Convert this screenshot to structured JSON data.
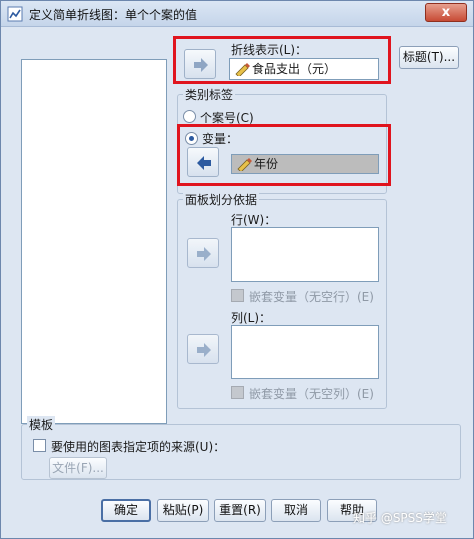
{
  "window": {
    "title": "定义简单折线图：单个个案的值",
    "close_label": "x"
  },
  "line_represents": {
    "label": "折线表示(L)：",
    "value": "食品支出（元）"
  },
  "titles_button": "标题(T)...",
  "category_labels": {
    "legend": "类别标签",
    "case_number_label": "个案号(C)",
    "variable_label": "变量：",
    "variable_value": "年份"
  },
  "panel_by": {
    "legend": "面板划分依据",
    "rows_label": "行(W)：",
    "rows_nest_label": "嵌套变量（无空行）(E)",
    "columns_label": "列(L)：",
    "columns_nest_label": "嵌套变量（无空列）(E)"
  },
  "template": {
    "legend": "模板",
    "use_spec_label": "要使用的图表指定项的来源(U)：",
    "file_button": "文件(F)..."
  },
  "buttons": {
    "ok": "确定",
    "paste": "粘贴(P)",
    "reset": "重置(R)",
    "cancel": "取消",
    "help": "帮助"
  },
  "watermark": "知乎 @SPSS学堂",
  "colors": {
    "window_bg": "#dde6f2",
    "highlight": "#e0141e",
    "arrow_blue": "#2c5aa0"
  }
}
